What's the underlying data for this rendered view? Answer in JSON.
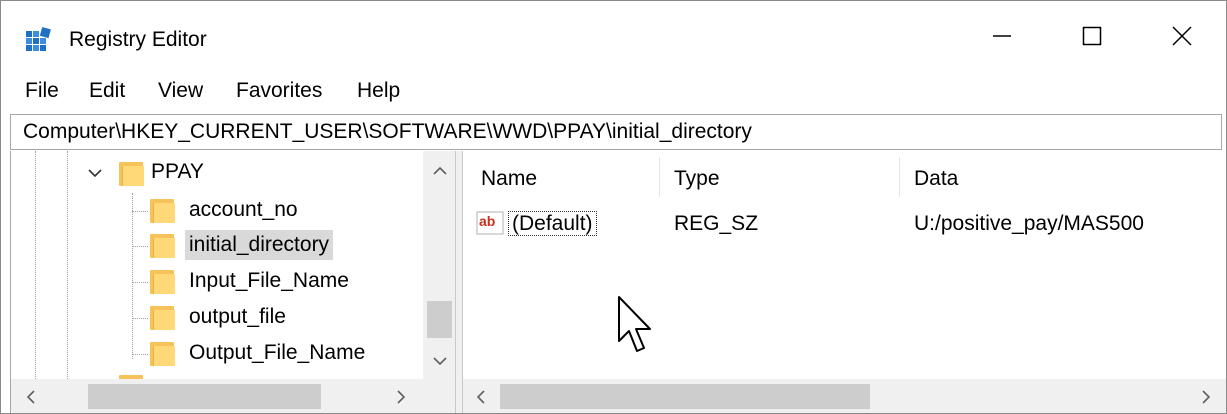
{
  "window": {
    "title": "Registry Editor",
    "controls": {
      "minimize": "—",
      "maximize": "☐",
      "close": "✕"
    }
  },
  "menu": [
    "File",
    "Edit",
    "View",
    "Favorites",
    "Help"
  ],
  "address": "Computer\\HKEY_CURRENT_USER\\SOFTWARE\\WWD\\PPAY\\initial_directory",
  "tree": {
    "parent": {
      "label": "PPAY",
      "expanded": true
    },
    "children": [
      {
        "label": "account_no"
      },
      {
        "label": "initial_directory",
        "selected": true
      },
      {
        "label": "Input_File_Name"
      },
      {
        "label": "output_file"
      },
      {
        "label": "Output_File_Name"
      }
    ]
  },
  "list": {
    "columns": [
      "Name",
      "Type",
      "Data"
    ],
    "rows": [
      {
        "name": "(Default)",
        "type": "REG_SZ",
        "data": "U:/positive_pay/MAS500",
        "icon": "string-value-icon",
        "icon_text": "ab"
      }
    ]
  },
  "scroll_arrows": {
    "up": "⌃",
    "down": "⌄",
    "left": "<",
    "right": ">"
  },
  "colors": {
    "accent": "#1f6fc5",
    "folder": "#ffd978",
    "selection": "#d9d9d9",
    "icon_red": "#c8311c"
  }
}
